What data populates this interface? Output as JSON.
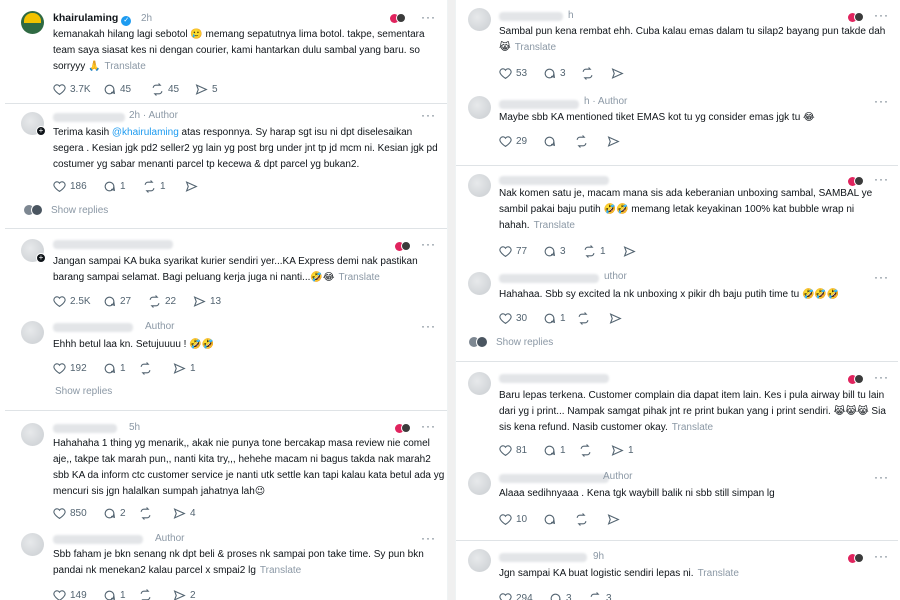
{
  "left": {
    "p1": {
      "username": "khairulaming",
      "time": "2h",
      "text": "kemanakah hilang lagi sebotol 🥲 memang sepatutnya lima botol. takpe, sementara team saya siasat kes ni dengan courier, kami hantarkan dulu sambal yang baru. so sorryyy 🙏",
      "translate": "Translate",
      "likes": "3.7K",
      "replies": "45",
      "reposts": "45",
      "shares": "5"
    },
    "p2": {
      "time": "2h",
      "author": "Author",
      "text_a": "Terima kasih ",
      "mention": "@khairulaming",
      "text_b": " atas responnya. Sy harap sgt isu ni dpt diselesaikan segera . Kesian jgk pd2 seller2 yg lain yg post brg under jnt tp jd mcm ni. Kesian jgk pd costumer yg sabar menanti parcel tp kecewa & dpt parcel yg bukan2.",
      "likes": "186",
      "replies": "1",
      "reposts": "1",
      "show_replies": "Show replies"
    },
    "p3": {
      "text": "Jangan sampai KA buka syarikat kurier sendiri yer...KA Express demi nak pastikan barang sampai selamat. Bagi peluang kerja juga ni nanti...🤣😂",
      "translate": "Translate",
      "likes": "2.5K",
      "replies": "27",
      "reposts": "22",
      "shares": "13"
    },
    "p4": {
      "author": "Author",
      "text": "Ehhh betul laa kn. Setujuuuu ! 🤣🤣",
      "likes": "192",
      "replies": "1",
      "shares": "1",
      "show_replies": "Show replies"
    },
    "p5": {
      "time": "5h",
      "text": "Hahahaha 1 thing yg menarik,, akak nie punya tone bercakap masa review nie comel aje,, takpe tak marah pun,, nanti kita try,,, hehehe macam ni bagus takda nak marah2 sbb KA da inform ctc customer service je nanti utk settle kan tapi kalau kata betul ada yg mencuri sis jgn halalkan sumpah jahatnya lah😉",
      "likes": "850",
      "replies": "2",
      "shares": "4"
    },
    "p6": {
      "author": "Author",
      "text": "Sbb faham je bkn senang nk dpt beli & proses nk sampai pon take time. Sy pun bkn pandai nk menekan2 kalau parcel x smpai2 lg",
      "translate": "Translate",
      "likes": "149",
      "replies": "1",
      "shares": "2"
    }
  },
  "right": {
    "r1": {
      "time": "h",
      "text": "Sambal pun kena rembat ehh. Cuba kalau emas dalam tu silap2 bayang pun takde dah 😹",
      "translate": "Translate",
      "likes": "53",
      "replies": "3"
    },
    "r2": {
      "time": "h",
      "author": "Author",
      "text": "Maybe sbb KA mentioned tiket EMAS kot tu yg consider emas jgk tu 😂",
      "likes": "29"
    },
    "r3": {
      "text": "Nak komen satu je, macam mana sis ada keberanian unboxing sambal, SAMBAL ye sambil pakai baju putih 🤣🤣 memang letak keyakinan 100% kat bubble wrap ni hahah.",
      "translate": "Translate",
      "likes": "77",
      "replies": "3",
      "reposts": "1"
    },
    "r4": {
      "author": "uthor",
      "text": "Hahahaa. Sbb sy excited la nk unboxing x pikir dh baju putih time tu 🤣🤣🤣",
      "likes": "30",
      "replies": "1",
      "show_replies": "Show replies"
    },
    "r5": {
      "text": "Baru lepas terkena. Customer complain dia dapat item lain. Kes i pula airway bill tu lain dari yg i print... Nampak samgat pihak jnt re print bukan yang i print sendiri. 😹😹😹 Sia sis kena refund. Nasib customer okay.",
      "translate": "Translate",
      "likes": "81",
      "replies": "1",
      "shares": "1"
    },
    "r6": {
      "author": "Author",
      "text": "Alaaa sedihnyaaa . Kena tgk waybill balik ni sbb still simpan lg",
      "likes": "10"
    },
    "r7": {
      "time": "9h",
      "text": "Jgn sampai KA buat logistic sendiri lepas ni.",
      "translate": "Translate",
      "likes": "294",
      "replies": "3",
      "reposts": "3"
    }
  },
  "colors": {
    "accent": "#1d9bf0",
    "muted": "#8b98a5",
    "text": "#0f1419"
  }
}
